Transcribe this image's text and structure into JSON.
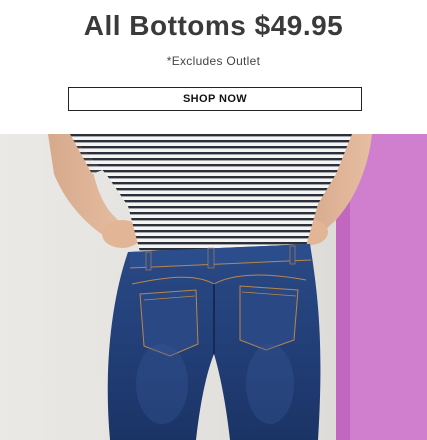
{
  "promo": {
    "headline": "All Bottoms $49.95",
    "subtext": "*Excludes Outlet",
    "cta_label": "SHOP NOW"
  },
  "hero_image": {
    "subject": "jeans-photo"
  },
  "colors": {
    "headline": "#3a3a3a",
    "backdrop_gray": "#e6e5e2",
    "backdrop_pink": "#c873c6",
    "denim": "#233f78"
  }
}
